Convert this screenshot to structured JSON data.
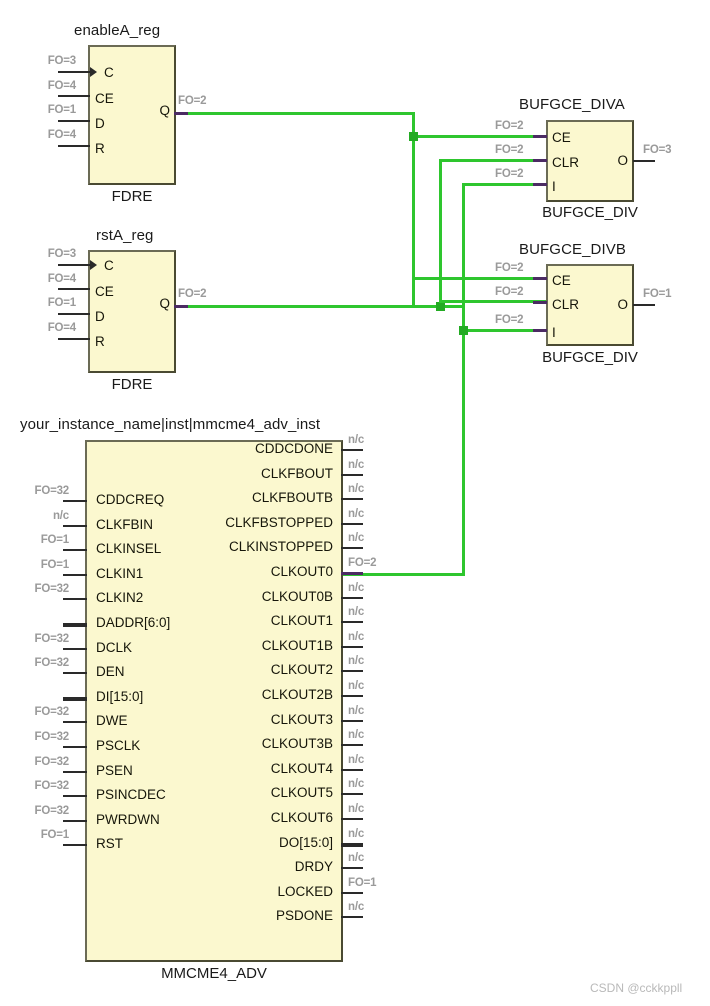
{
  "diagram": {
    "title": "Xilinx Vivado RTL/Technology Schematic - MMCME4_ADV clocking",
    "watermark": "CSDN @cckkppll",
    "colors": {
      "block_fill": "#fbf8cf",
      "block_border": "#4a4a32",
      "wire": "#2ec62e",
      "net_label": "#9a9a9a",
      "pin": "#2a2a2a"
    }
  },
  "blocks": {
    "enableA_reg": {
      "instance": "enableA_reg",
      "primitive": "FDRE",
      "inputs": [
        {
          "pin": "C",
          "net": "FO=3",
          "clock": true
        },
        {
          "pin": "CE",
          "net": "FO=4"
        },
        {
          "pin": "D",
          "net": "FO=1"
        },
        {
          "pin": "R",
          "net": "FO=4"
        }
      ],
      "outputs": [
        {
          "pin": "Q",
          "net": "FO=2"
        }
      ]
    },
    "rstA_reg": {
      "instance": "rstA_reg",
      "primitive": "FDRE",
      "inputs": [
        {
          "pin": "C",
          "net": "FO=3",
          "clock": true
        },
        {
          "pin": "CE",
          "net": "FO=4"
        },
        {
          "pin": "D",
          "net": "FO=1"
        },
        {
          "pin": "R",
          "net": "FO=4"
        }
      ],
      "outputs": [
        {
          "pin": "Q",
          "net": "FO=2"
        }
      ]
    },
    "bufgce_diva": {
      "instance": "BUFGCE_DIVA",
      "primitive": "BUFGCE_DIV",
      "inputs": [
        {
          "pin": "CE",
          "net": "FO=2"
        },
        {
          "pin": "CLR",
          "net": "FO=2"
        },
        {
          "pin": "I",
          "net": "FO=2"
        }
      ],
      "outputs": [
        {
          "pin": "O",
          "net": "FO=3"
        }
      ]
    },
    "bufgce_divb": {
      "instance": "BUFGCE_DIVB",
      "primitive": "BUFGCE_DIV",
      "inputs": [
        {
          "pin": "CE",
          "net": "FO=2"
        },
        {
          "pin": "CLR",
          "net": "FO=2"
        },
        {
          "pin": "I",
          "net": "FO=2"
        }
      ],
      "outputs": [
        {
          "pin": "O",
          "net": "FO=1"
        }
      ]
    },
    "mmcme4": {
      "instance": "your_instance_name|inst|mmcme4_adv_inst",
      "primitive": "MMCME4_ADV",
      "inputs": [
        {
          "pin": "CDDCREQ",
          "net": "FO=32"
        },
        {
          "pin": "CLKFBIN",
          "net": "n/c"
        },
        {
          "pin": "CLKINSEL",
          "net": "FO=1"
        },
        {
          "pin": "CLKIN1",
          "net": "FO=1"
        },
        {
          "pin": "CLKIN2",
          "net": "FO=32"
        },
        {
          "pin": "DADDR[6:0]",
          "net": "",
          "bus": true
        },
        {
          "pin": "DCLK",
          "net": "FO=32"
        },
        {
          "pin": "DEN",
          "net": "FO=32"
        },
        {
          "pin": "DI[15:0]",
          "net": "",
          "bus": true
        },
        {
          "pin": "DWE",
          "net": "FO=32"
        },
        {
          "pin": "PSCLK",
          "net": "FO=32"
        },
        {
          "pin": "PSEN",
          "net": "FO=32"
        },
        {
          "pin": "PSINCDEC",
          "net": "FO=32"
        },
        {
          "pin": "PWRDWN",
          "net": "FO=32"
        },
        {
          "pin": "RST",
          "net": "FO=1"
        }
      ],
      "outputs": [
        {
          "pin": "CDDCDONE",
          "net": "n/c"
        },
        {
          "pin": "CLKFBOUT",
          "net": "n/c"
        },
        {
          "pin": "CLKFBOUTB",
          "net": "n/c"
        },
        {
          "pin": "CLKFBSTOPPED",
          "net": "n/c"
        },
        {
          "pin": "CLKINSTOPPED",
          "net": "n/c"
        },
        {
          "pin": "CLKOUT0",
          "net": "FO=2",
          "connected": true
        },
        {
          "pin": "CLKOUT0B",
          "net": "n/c"
        },
        {
          "pin": "CLKOUT1",
          "net": "n/c"
        },
        {
          "pin": "CLKOUT1B",
          "net": "n/c"
        },
        {
          "pin": "CLKOUT2",
          "net": "n/c"
        },
        {
          "pin": "CLKOUT2B",
          "net": "n/c"
        },
        {
          "pin": "CLKOUT3",
          "net": "n/c"
        },
        {
          "pin": "CLKOUT3B",
          "net": "n/c"
        },
        {
          "pin": "CLKOUT4",
          "net": "n/c"
        },
        {
          "pin": "CLKOUT5",
          "net": "n/c"
        },
        {
          "pin": "CLKOUT6",
          "net": "n/c"
        },
        {
          "pin": "DO[15:0]",
          "net": "n/c",
          "bus": true
        },
        {
          "pin": "DRDY",
          "net": "n/c"
        },
        {
          "pin": "LOCKED",
          "net": "FO=1"
        },
        {
          "pin": "PSDONE",
          "net": "n/c"
        }
      ]
    }
  }
}
